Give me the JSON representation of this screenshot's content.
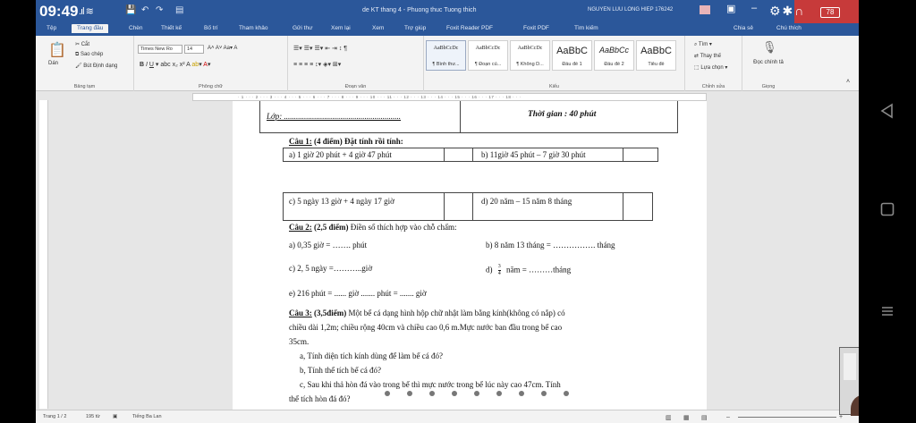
{
  "status_bar": {
    "time": "09:49",
    "battery": "78"
  },
  "window": {
    "doc_title": "de KT thang 4 - Phuong thuc Tuong thich",
    "user_name": "NGUYEN LUU LONG HIEP 176242"
  },
  "tabs": [
    "Tệp",
    "Trang đầu",
    "Chèn",
    "Thiết kế",
    "Bố trí",
    "Tham khảo",
    "Gửi thư",
    "Xem lại",
    "Xem",
    "Trợ giúp",
    "Foxit Reader PDF",
    "Foxit PDF",
    "Tìm kiếm",
    "Chia sẻ",
    "Chú thích"
  ],
  "ribbon": {
    "clipboard": {
      "paste": "Dán",
      "cut": "Cắt",
      "copy": "Sao chép",
      "format_painter": "Bút Định dạng",
      "label": "Bảng tạm"
    },
    "font": {
      "font_name": "Times New Ro",
      "font_size": "14",
      "label": "Phông chữ"
    },
    "paragraph": {
      "label": "Đoạn văn"
    },
    "styles": {
      "label": "Kiểu",
      "items": [
        {
          "sample": "AaBbCcDc",
          "name": "¶ Bình thư..."
        },
        {
          "sample": "AaBbCcDc",
          "name": "¶ Đoạn củ..."
        },
        {
          "sample": "AaBbCcDc",
          "name": "¶ Không D..."
        },
        {
          "sample": "AaBbC",
          "name": "Đầu đề 1"
        },
        {
          "sample": "AaBbCc",
          "name": "Đầu đề 2"
        },
        {
          "sample": "AaBbC",
          "name": "Tiêu đề"
        }
      ]
    },
    "editing": {
      "find": "Tìm",
      "replace": "Thay thế",
      "select": "Lựa chọn",
      "label": "Chỉnh sửa"
    },
    "voice": {
      "dictate": "Đọc chính tả",
      "label": "Giọng"
    }
  },
  "document": {
    "header_left": "Lớp: ..........................................................",
    "header_right": "Thời gian : 40 phút",
    "q1": {
      "num": "Câu 1:",
      "points": "(4 điểm)",
      "text": "Đặt tính rồi tính:"
    },
    "q1_items": [
      "a) 1 giờ 20 phút + 4 giờ 47 phút",
      "b) 11giờ 45 phút – 7 giờ 30 phút",
      "c) 5 ngày 13 giờ  +  4 ngày 17 giờ",
      "d) 20 năm  – 15 năm 8 tháng"
    ],
    "q2": {
      "num": "Câu 2:",
      "points": "(2,5 điểm)",
      "text": "Điền số thích hợp vào chỗ chấm:"
    },
    "q2_items": [
      "a) 0,35 giờ = ……. phút",
      "b) 8 năm 13 tháng = ……………. tháng",
      "c) 2, 5 ngày =………..giờ",
      "năm = ………tháng",
      "e) 216 phút = ...... giờ ....... phút = ....... giờ"
    ],
    "q2_d_prefix": "d)",
    "fraction": {
      "num": "3",
      "den": "4"
    },
    "q3": {
      "num": "Câu 3:",
      "points": "(3,5điểm)",
      "text": "Một bể cá dạng hình hộp chữ nhật làm bằng kính(không có nắp) có"
    },
    "q3_lines": [
      "chiều dài 1,2m; chiều rộng 40cm và chiều cao 0,6 m.Mực nước ban đầu trong bể cao",
      "35cm.",
      "a, Tính diện tích kính dùng để làm bể cá đó?",
      "b, Tính thể tích bể cá đó?",
      "c, Sau khi thả hòn đá vào trong bể thì mực nước trong bể lúc này cao 47cm. Tính",
      "thể tích hòn đá đó?"
    ]
  },
  "statusbar": {
    "page": "Trang 1 / 2",
    "words": "195 từ",
    "language": "Tiếng Ba Lan"
  }
}
